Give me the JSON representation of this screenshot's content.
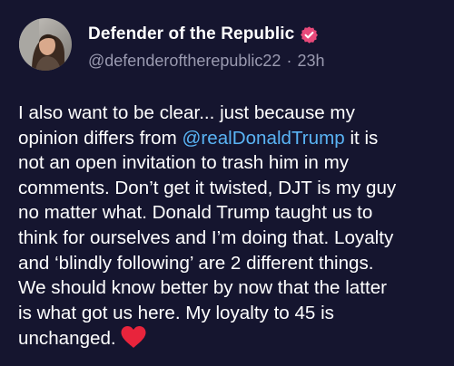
{
  "post": {
    "author": {
      "display_name": "Defender of the Republic",
      "handle": "@defenderoftherepublic22",
      "separator": "·",
      "time": "23h",
      "verified_icon": "verified-check-badge-icon",
      "verified_color": "#e8497a"
    },
    "body": {
      "line1": "I also want to be clear... just because my",
      "line2_pre": "opinion differs from ",
      "line2_mention": "@realDonaldTrump",
      "line2_post": " it is",
      "line3": "not an open invitation to trash him in my",
      "line4": "comments. Don’t get it twisted, DJT is my guy",
      "line5": "no matter what. Donald Trump taught us to",
      "line6": "think for ourselves and I’m doing that. Loyalty",
      "line7": "and ‘blindly following’ are 2 different things.",
      "line8": "We should know better by now that the latter",
      "line9": "is what got us here. My loyalty to 45 is",
      "line10": "unchanged.",
      "end_emoji": "red-heart-icon"
    },
    "colors": {
      "background": "#15152f",
      "mention": "#5ab4f5",
      "secondary_text": "#9a9ab0",
      "heart": "#e8243c"
    }
  }
}
